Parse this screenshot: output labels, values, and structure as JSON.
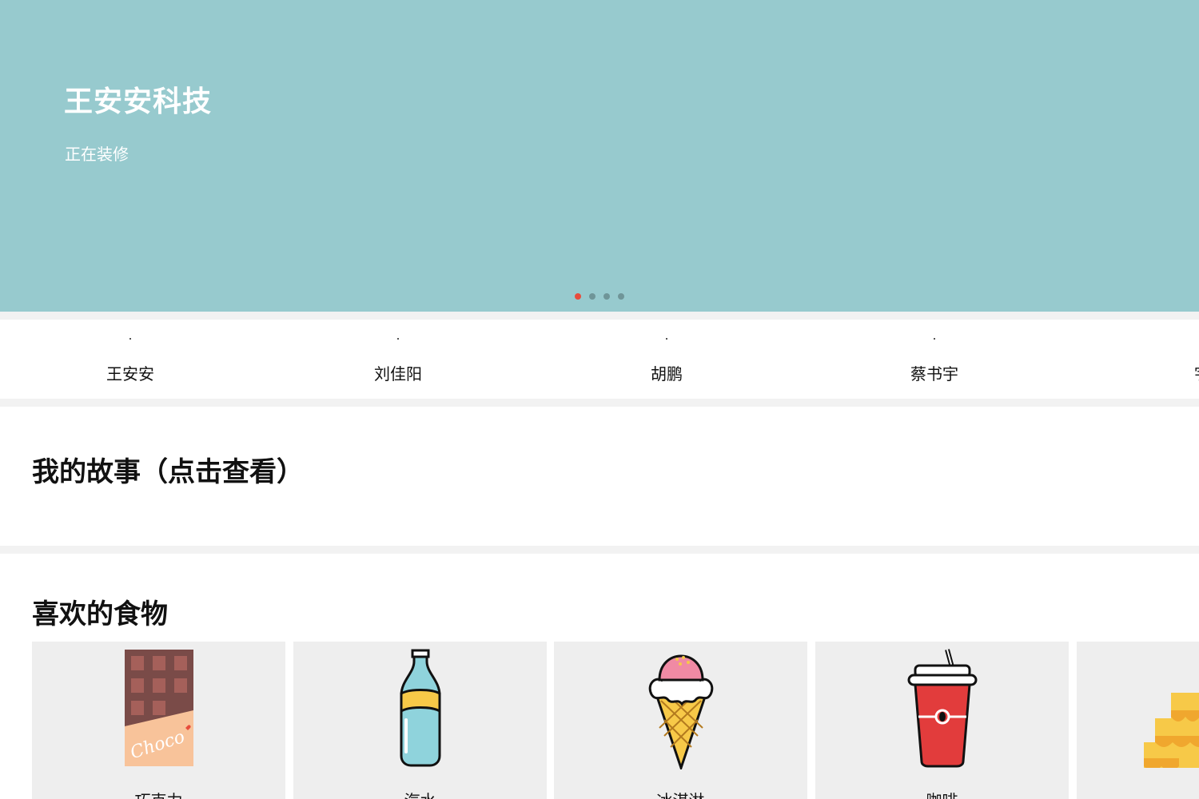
{
  "hero": {
    "title": "王安安科技",
    "subtitle": "正在装修",
    "background_color": "#97cace",
    "active_dot_color": "#e74c3c",
    "dot_count": 4,
    "active_dot": 1
  },
  "people": [
    {
      "name": "王安安"
    },
    {
      "name": "刘佳阳"
    },
    {
      "name": "胡鹏"
    },
    {
      "name": "蔡书宇"
    },
    {
      "name": "宇"
    }
  ],
  "story": {
    "title": "我的故事（点击查看）"
  },
  "foods": {
    "title": "喜欢的食物",
    "items": [
      {
        "label": "巧克力",
        "icon": "chocolate-icon",
        "icon_text": "Choco"
      },
      {
        "label": "汽水",
        "icon": "soda-bottle-icon"
      },
      {
        "label": "冰淇淋",
        "icon": "ice-cream-icon"
      },
      {
        "label": "咖啡",
        "icon": "coffee-cup-icon"
      },
      {
        "label": "",
        "icon": "cake-icon"
      }
    ]
  }
}
